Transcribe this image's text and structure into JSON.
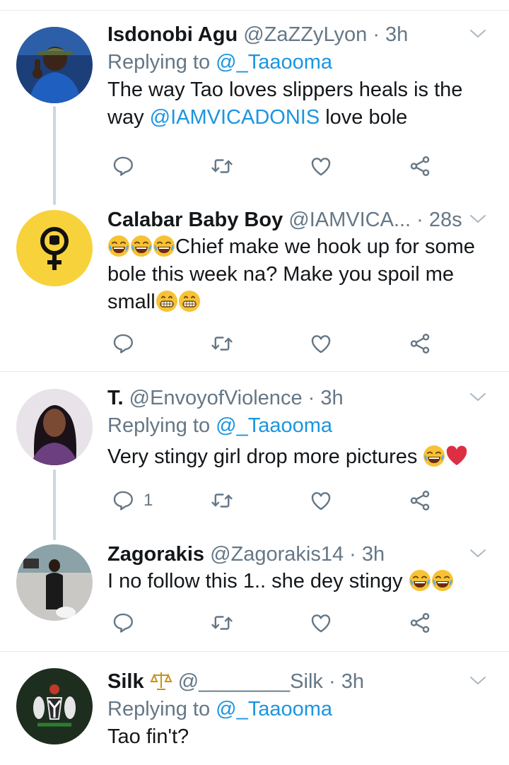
{
  "tweets": [
    {
      "name": "Isdonobi Agu",
      "handle": "@ZaZZyLyon",
      "dot": " · ",
      "time": "3h",
      "replying_prefix": "Replying to ",
      "replying_to": "@_Taaooma",
      "text_1": "The way  Tao loves slippers heals is the way ",
      "mention": "@IAMVICADONIS",
      "text_2": " love bole",
      "reply_count": ""
    },
    {
      "name": "Calabar Baby Boy",
      "handle": "@IAMVICA...",
      "dot": "  · ",
      "time": "28s",
      "text_1": "Chief make we hook up for some bole this week na? Make you spoil me small",
      "reply_count": ""
    },
    {
      "name": "T.",
      "handle": "@EnvoyofViolence",
      "dot": " · ",
      "time": "3h",
      "replying_prefix": "Replying to ",
      "replying_to": "@_Taaooma",
      "text_1": "Very stingy girl drop more pictures ",
      "reply_count": "1"
    },
    {
      "name": "Zagorakis",
      "handle": "@Zagorakis14",
      "dot": " · ",
      "time": "3h",
      "text_1": "I no follow this 1.. she dey stingy ",
      "reply_count": ""
    },
    {
      "name": "Silk",
      "handle": "@________Silk",
      "dot": " · ",
      "time": "3h",
      "replying_prefix": "Replying to ",
      "replying_to": "@_Taaooma",
      "text_1": "Tao fin't?"
    }
  ],
  "icons": {
    "reply": "reply-icon",
    "retweet": "retweet-icon",
    "like": "like-icon",
    "share": "share-icon",
    "caret": "chevron-down-icon"
  },
  "colors": {
    "link": "#1b95e0",
    "secondary": "#657786",
    "icon": "#657786",
    "divider": "#e6ecf0"
  }
}
